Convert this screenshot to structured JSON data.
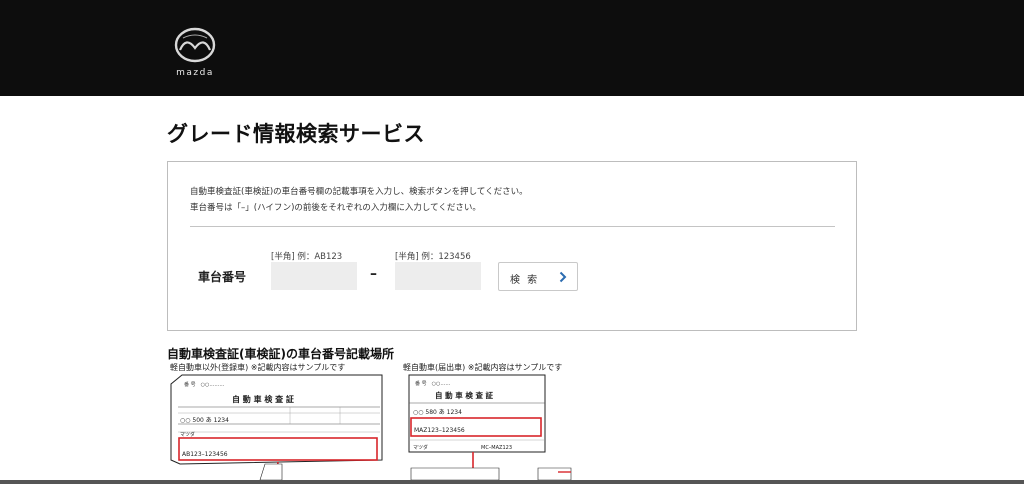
{
  "header": {
    "brand": "mazda"
  },
  "page": {
    "title": "グレード情報検索サービス"
  },
  "search_panel": {
    "instruction_1": "自動車検査証(車検証)の車台番号欄の記載事項を入力し、検索ボタンを押してください。",
    "instruction_2": "車台番号は「–」(ハイフン)の前後をそれぞれの入力欄に入力してください。",
    "field_label": "車台番号",
    "input_1": {
      "hint": "[半角] 例：AB123",
      "value": "",
      "placeholder": ""
    },
    "separator": "–",
    "input_2": {
      "hint": "[半角] 例：123456",
      "value": "",
      "placeholder": ""
    },
    "search_button": "検 索"
  },
  "samples": {
    "section_title": "自動車検査証(車検証)の車台番号記載場所",
    "sample_1": {
      "caption": "軽自動車以外(登録車) ※記載内容はサンプルです",
      "doc_title": "自 動 車 検 査 証",
      "registration": "○○ 500 あ 1234",
      "maker": "マツダ",
      "chassis_number": "AB123–123456"
    },
    "sample_2": {
      "caption": "軽自動車(届出車) ※記載内容はサンプルです",
      "doc_title": "自 動 車 検 査 証",
      "registration": "○○ 580 あ 1234",
      "chassis_number": "MAZ123–123456",
      "maker": "マツダ",
      "model": "MC–MAZ123"
    }
  },
  "colors": {
    "header_bg": "#0d0d0d",
    "input_bg": "#ededed",
    "highlight_red": "#d9262b",
    "chevron_blue": "#2b6cb0"
  }
}
